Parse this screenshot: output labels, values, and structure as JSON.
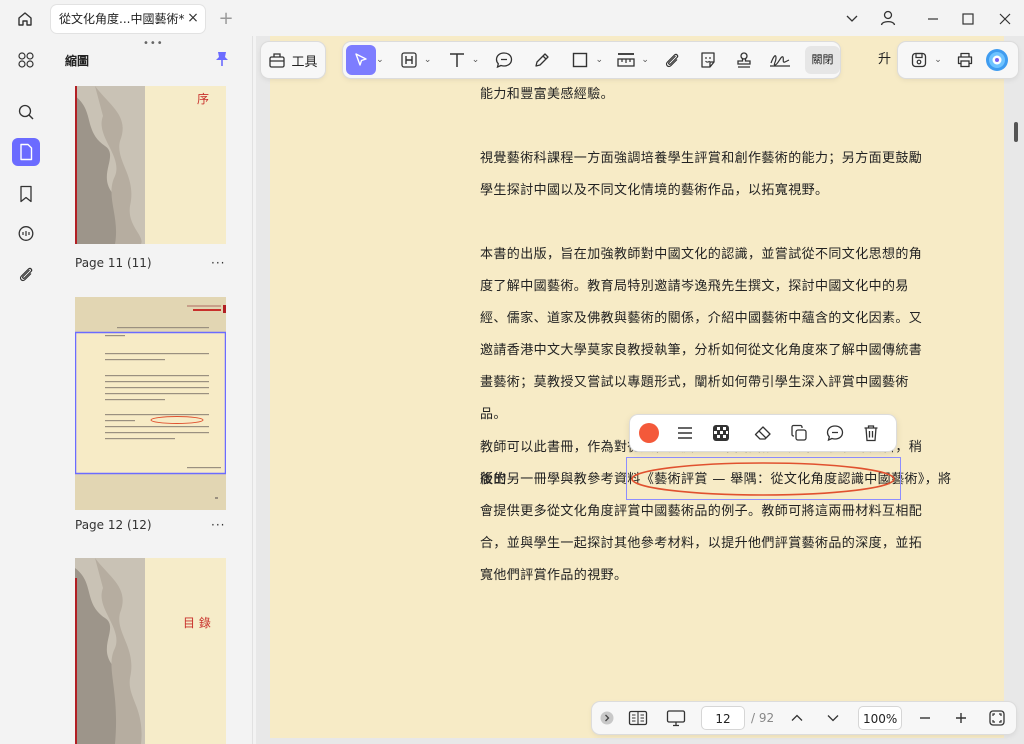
{
  "window": {
    "tab_title": "從文化角度...中國藝術*",
    "tab_close": "×",
    "new_tab": "+"
  },
  "sidebar": {
    "title": "縮圖",
    "thumbnails": [
      {
        "label": "Page 11 (11)",
        "heading": "序"
      },
      {
        "label": "Page 12 (12)",
        "heading": ""
      },
      {
        "label": "",
        "heading": "目 錄"
      }
    ],
    "more": "···"
  },
  "toolbar": {
    "tools_label": "工具",
    "close_label": "關閉",
    "partial_text": "升"
  },
  "document": {
    "paragraphs": [
      "能力和豐富美感經驗。",
      "視覺藝術科課程一方面強調培養學生評賞和創作藝術的能力；另方面更鼓勵學生探討中國以及不同文化情境的藝術作品，以拓寬視野。",
      "本書的出版，旨在加強教師對中國文化的認識，並嘗試從不同文化思想的角度了解中國藝術。教育局特別邀請岑逸飛先生撰文，探討中國文化中的易經、儒家、道家及佛教與藝術的關係，介紹中國藝術中蘊含的文化因素。又邀請香港中文大學莫家良教授執筆，分析如何從文化角度來了解中國傳統書畫藝術；莫教授又嘗試以專題形式，闡析如何帶引學生深入評賞中國藝術品。"
    ],
    "last_para_line1": "教師可以此書冊，作為對從文化角度探討中國藝術的其中一份參考資料，稍後出",
    "last_para_line2_pre": "版的另一冊學與教參考資料",
    "highlighted": "《藝術評賞 — 舉隅：從文化角度認識中國藝術》",
    "last_para_line2_post": "，將",
    "last_para_rest": "會提供更多從文化角度評賞中國藝術品的例子。教師可將這兩冊材料互相配合，並與學生一起探討其他參考材料，以提升他們評賞藝術品的深度，並拓寬他們評賞作品的視野。"
  },
  "annotation_toolbar": {
    "color": "#f4593a",
    "icons": [
      "color-swatch-icon",
      "line-weight-icon",
      "opacity-icon",
      "eraser-icon",
      "copy-icon",
      "comment-icon",
      "trash-icon"
    ]
  },
  "bottom_bar": {
    "page_current": "12",
    "page_total": "/ 92",
    "zoom": "100%"
  },
  "colors": {
    "accent": "#6b6bff",
    "paper": "#f7ebc6",
    "ink_red": "#e0512f"
  }
}
